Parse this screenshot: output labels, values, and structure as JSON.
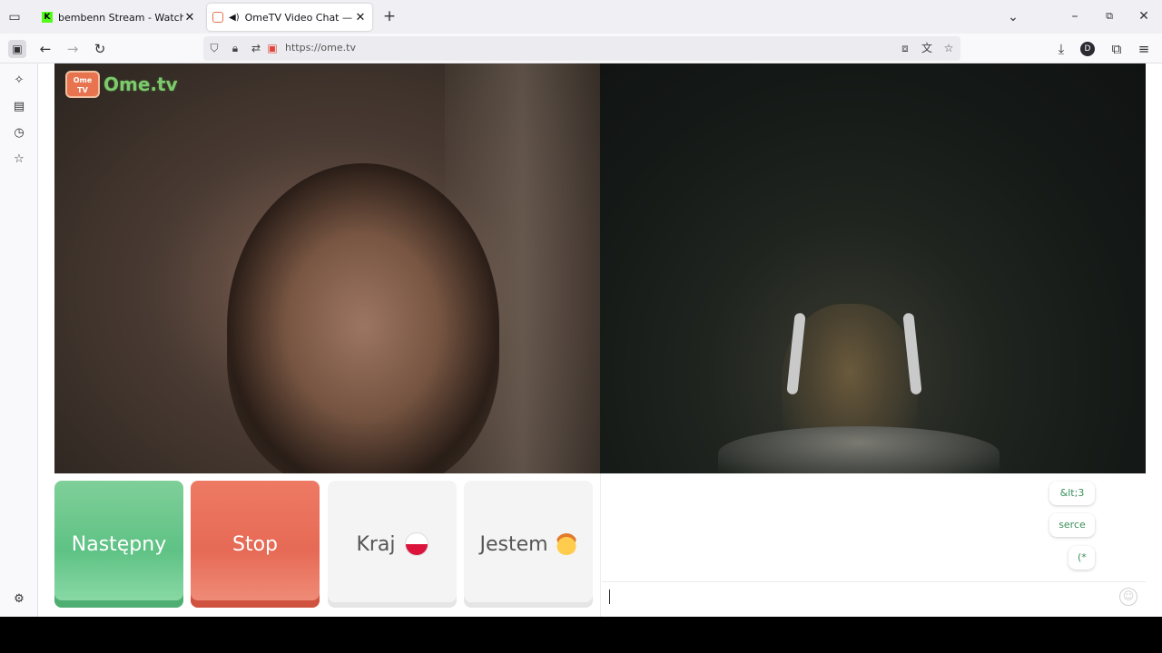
{
  "browser": {
    "tabs": [
      {
        "title": "bembenn Stream - Watch Live o",
        "favicon": "kick-icon",
        "active": false
      },
      {
        "title": "OmeTV Video Chat — Ome",
        "favicon": "ometv-icon",
        "active": true
      }
    ],
    "url": "https://ome.tv"
  },
  "page": {
    "logo_box_text": "Ome TV",
    "logo_text": "Ome.tv",
    "buttons": {
      "next": "Następny",
      "stop": "Stop",
      "country": "Kraj",
      "gender": "Jestem"
    },
    "quick_replies": [
      "&lt;3",
      "serce",
      "(*"
    ],
    "colors": {
      "next": "#5fc285",
      "stop": "#e66a55",
      "logo_green": "#7ec86d",
      "logo_orange": "#e8734f"
    }
  }
}
